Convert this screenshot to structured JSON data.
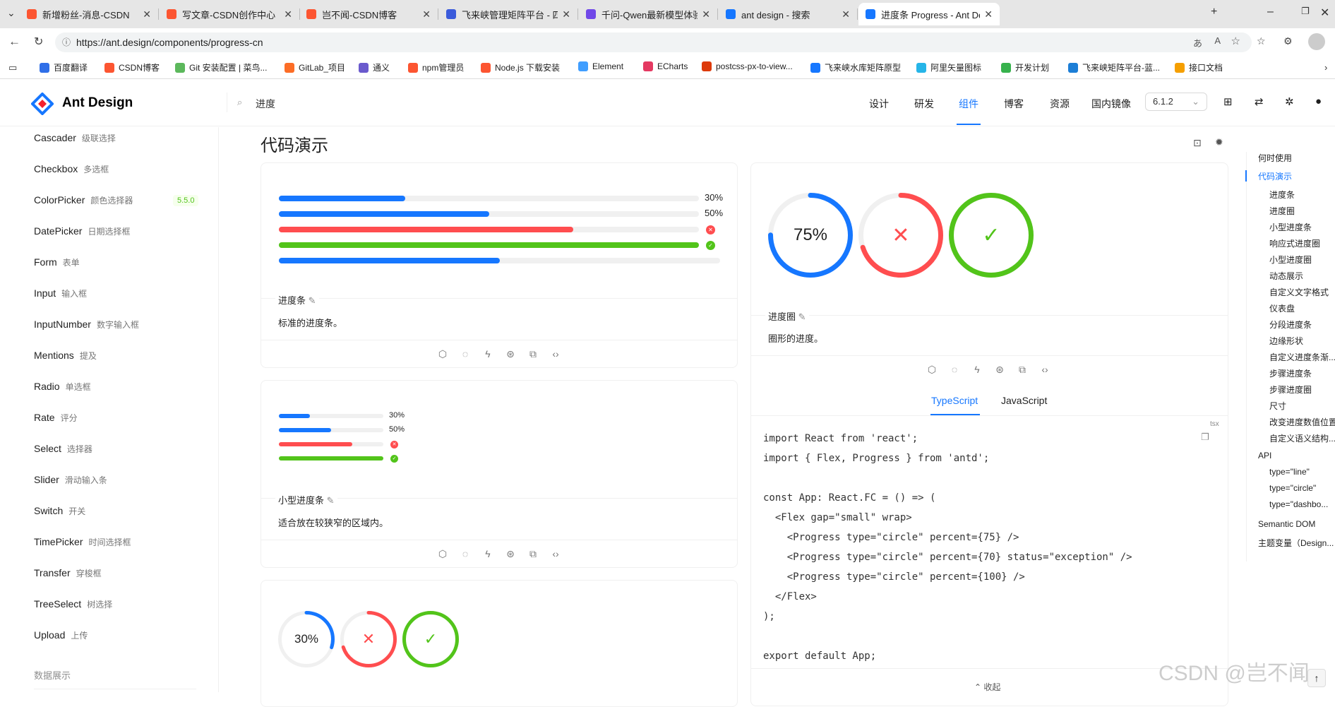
{
  "browser": {
    "tabs": [
      {
        "title": "新增粉丝-消息-CSDN",
        "color": "#fc5531"
      },
      {
        "title": "写文章-CSDN创作中心",
        "color": "#fc5531"
      },
      {
        "title": "岂不闻-CSDN博客",
        "color": "#fc5531"
      },
      {
        "title": "飞来峡管理矩阵平台 - 四制（治）",
        "color": "#3b5bdb"
      },
      {
        "title": "千问-Qwen最新模型体验-通义千问",
        "color": "#7048e8"
      },
      {
        "title": "ant design - 搜索",
        "color": "#1677ff"
      },
      {
        "title": "进度条 Progress - Ant Design",
        "color": "#1677ff"
      }
    ],
    "url": "https://ant.design/components/progress-cn",
    "bookmarks": [
      {
        "label": "百度翻译",
        "color": "#2f6fe8"
      },
      {
        "label": "CSDN博客",
        "color": "#fc5531"
      },
      {
        "label": "Git 安装配置 | 菜鸟...",
        "color": "#5cb85c"
      },
      {
        "label": "GitLab_项目",
        "color": "#fc6d26"
      },
      {
        "label": "通义",
        "color": "#6a5acd"
      },
      {
        "label": "npm管理员",
        "color": "#fc5531"
      },
      {
        "label": "Node.js 下载安装",
        "color": "#fc5531"
      },
      {
        "label": "Element",
        "color": "#409eff"
      },
      {
        "label": "ECharts",
        "color": "#e43961"
      },
      {
        "label": "postcss-px-to-view...",
        "color": "#dd3a0a"
      },
      {
        "label": "飞来峡水库矩阵原型",
        "color": "#1677ff"
      },
      {
        "label": "阿里矢量图标",
        "color": "#26b5e8"
      },
      {
        "label": "开发计划",
        "color": "#37b24d"
      },
      {
        "label": "飞来峡矩阵平台-蓝...",
        "color": "#1c7ed6"
      },
      {
        "label": "接口文档",
        "color": "#f59f00"
      }
    ]
  },
  "site": {
    "brand": "Ant Design",
    "search_value": "进度",
    "nav": [
      "设计",
      "研发",
      "组件",
      "博客",
      "资源",
      "国内镜像"
    ],
    "active_nav": "组件",
    "version": "6.1.2"
  },
  "sidebar": {
    "items": [
      {
        "en": "Cascader",
        "zh": "级联选择"
      },
      {
        "en": "Checkbox",
        "zh": "多选框"
      },
      {
        "en": "ColorPicker",
        "zh": "颜色选择器",
        "badge": "5.5.0"
      },
      {
        "en": "DatePicker",
        "zh": "日期选择框"
      },
      {
        "en": "Form",
        "zh": "表单"
      },
      {
        "en": "Input",
        "zh": "输入框"
      },
      {
        "en": "InputNumber",
        "zh": "数字输入框"
      },
      {
        "en": "Mentions",
        "zh": "提及"
      },
      {
        "en": "Radio",
        "zh": "单选框"
      },
      {
        "en": "Rate",
        "zh": "评分"
      },
      {
        "en": "Select",
        "zh": "选择器"
      },
      {
        "en": "Slider",
        "zh": "滑动输入条"
      },
      {
        "en": "Switch",
        "zh": "开关"
      },
      {
        "en": "TimePicker",
        "zh": "时间选择框"
      },
      {
        "en": "Transfer",
        "zh": "穿梭框"
      },
      {
        "en": "TreeSelect",
        "zh": "树选择"
      },
      {
        "en": "Upload",
        "zh": "上传"
      }
    ],
    "group": "数据展示"
  },
  "main": {
    "section_title": "代码演示",
    "demo1": {
      "title": "进度条",
      "desc": "标准的进度条。",
      "bars": [
        {
          "percent": 30,
          "status": "normal",
          "label": "30%"
        },
        {
          "percent": 50,
          "status": "active",
          "label": "50%"
        },
        {
          "percent": 70,
          "status": "exception",
          "label": ""
        },
        {
          "percent": 100,
          "status": "success",
          "label": ""
        },
        {
          "percent": 50,
          "status": "noinfo",
          "label": ""
        }
      ]
    },
    "demo2": {
      "title": "小型进度条",
      "desc": "适合放在较狭窄的区域内。",
      "bars": [
        {
          "percent": 30,
          "status": "normal",
          "label": "30%"
        },
        {
          "percent": 50,
          "status": "active",
          "label": "50%"
        },
        {
          "percent": 70,
          "status": "exception",
          "label": ""
        },
        {
          "percent": 100,
          "status": "success",
          "label": ""
        }
      ]
    },
    "demo3": {
      "circles": [
        {
          "percent": 30,
          "status": "normal",
          "label": "30%"
        },
        {
          "percent": 70,
          "status": "exception",
          "label": ""
        },
        {
          "percent": 100,
          "status": "success",
          "label": ""
        }
      ]
    },
    "demo_circle": {
      "title": "进度圈",
      "desc": "圈形的进度。",
      "circles": [
        {
          "percent": 75,
          "status": "normal",
          "label": "75%"
        },
        {
          "percent": 70,
          "status": "exception",
          "label": ""
        },
        {
          "percent": 100,
          "status": "success",
          "label": ""
        }
      ],
      "code_tabs": [
        "TypeScript",
        "JavaScript"
      ],
      "active_code_tab": "TypeScript",
      "lang_tag": "tsx",
      "collapse_label": "收起",
      "code_lines": [
        "import React from 'react';",
        "import { Flex, Progress } from 'antd';",
        "",
        "const App: React.FC = () => (",
        "  <Flex gap=\"small\" wrap>",
        "    <Progress type=\"circle\" percent={75} />",
        "    <Progress type=\"circle\" percent={70} status=\"exception\" />",
        "    <Progress type=\"circle\" percent={100} />",
        "  </Flex>",
        ");",
        "",
        "export default App;"
      ]
    }
  },
  "toc": {
    "items": [
      "何时使用",
      "代码演示",
      "进度条",
      "进度圈",
      "小型进度条",
      "响应式进度圈",
      "小型进度圈",
      "动态展示",
      "自定义文字格式",
      "仪表盘",
      "分段进度条",
      "边缘形状",
      "自定义进度条渐...",
      "步骤进度条",
      "步骤进度圈",
      "尺寸",
      "改变进度数值位置",
      "自定义语义结构...",
      "API",
      "type=\"line\"",
      "type=\"circle\"",
      "type=\"dashbo...",
      "Semantic DOM",
      "主题变量（Design..."
    ],
    "active": "代码演示"
  },
  "watermark": "CSDN @岂不闻",
  "colors": {
    "primary": "#1677ff",
    "exception": "#ff4d4f",
    "success": "#52c41a",
    "track": "#f0f0f0"
  }
}
